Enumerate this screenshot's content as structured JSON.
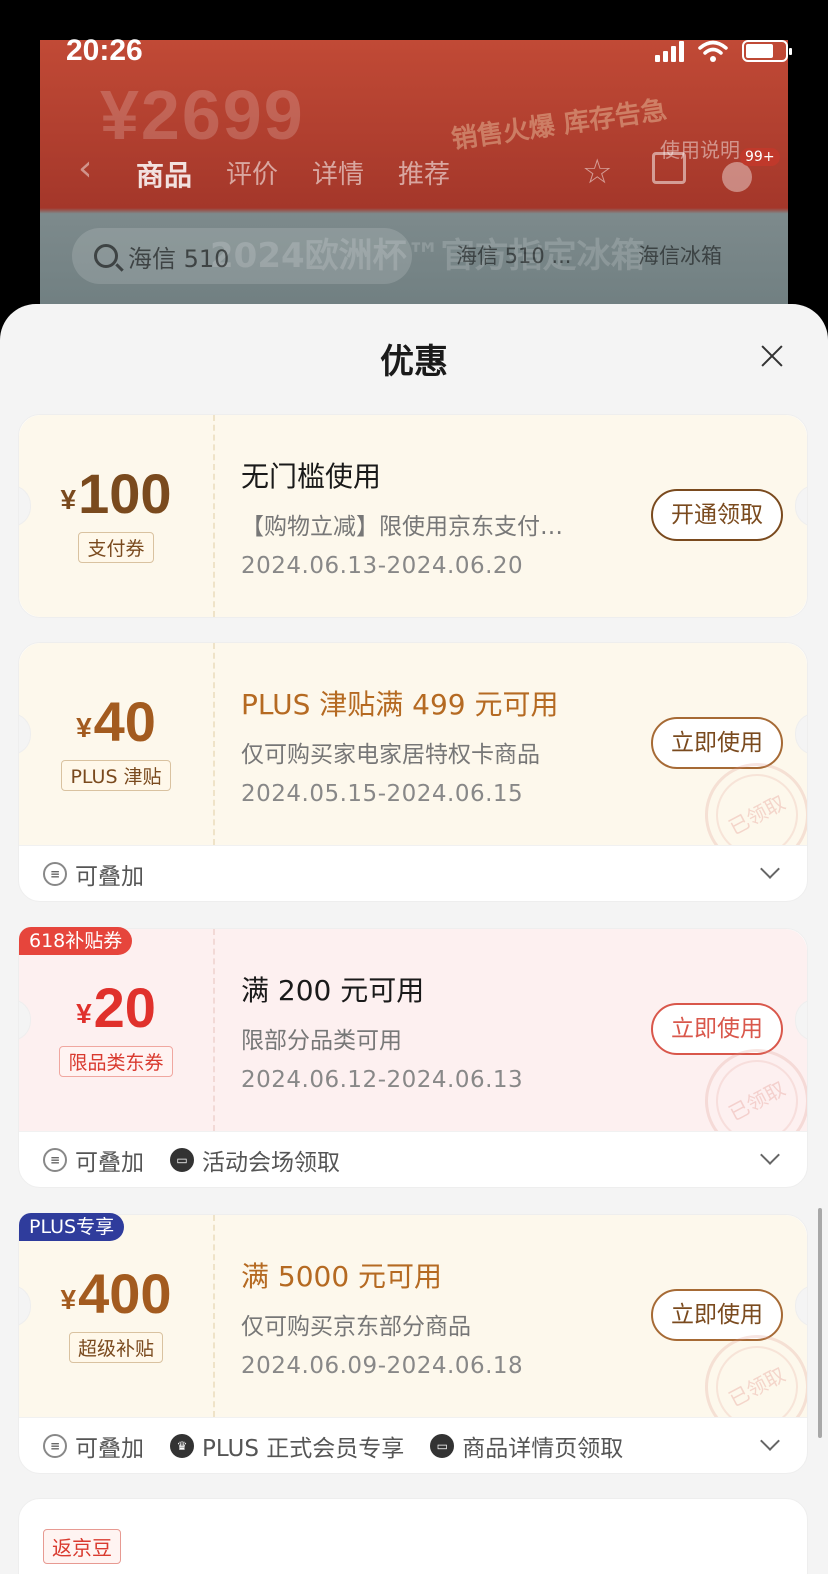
{
  "status_bar": {
    "time": "20:26"
  },
  "background_page": {
    "banner_price": "¥2699",
    "banner_promo": "销售火爆 库存告急",
    "banner_euro": "2024欧洲杯™官方指定冰箱",
    "tabs": [
      "商品",
      "评价",
      "详情",
      "推荐"
    ],
    "help_label": "使用说明",
    "cart_badge": "99+",
    "search_text": "海信 510",
    "chips": [
      "海信 510 ...",
      "海信冰箱"
    ]
  },
  "sheet": {
    "title": "优惠",
    "coupons": [
      {
        "currency": "¥",
        "amount": "100",
        "type": "支付券",
        "title": "无门槛使用",
        "desc": "【购物立减】限使用京东支付…",
        "date": "2024.06.13-2024.06.20",
        "action": "开通领取"
      },
      {
        "currency": "¥",
        "amount": "40",
        "type": "PLUS 津贴",
        "title": "PLUS 津贴满 499 元可用",
        "desc": "仅可购买家电家居特权卡商品",
        "date": "2024.05.15-2024.06.15",
        "action": "立即使用",
        "stamp": "已领取",
        "features": [
          "可叠加"
        ]
      },
      {
        "corner_tag": "618补贴券",
        "currency": "¥",
        "amount": "20",
        "type": "限品类东券",
        "title": "满 200 元可用",
        "desc": "限部分品类可用",
        "date": "2024.06.12-2024.06.13",
        "action": "立即使用",
        "stamp": "已领取",
        "features": [
          "可叠加",
          "活动会场领取"
        ]
      },
      {
        "corner_tag": "PLUS专享",
        "currency": "¥",
        "amount": "400",
        "type": "超级补贴",
        "title": "满 5000 元可用",
        "desc": "仅可购买京东部分商品",
        "date": "2024.06.09-2024.06.18",
        "action": "立即使用",
        "stamp": "已领取",
        "features": [
          "可叠加",
          "PLUS 正式会员专享",
          "商品详情页领取"
        ]
      }
    ],
    "partial_card_tag": "返京豆"
  },
  "colors": {
    "coupon_brown": "#7a4a1e",
    "coupon_red": "#e0312c",
    "plus_gold": "#b56a22",
    "tag_red": "#e6453c",
    "tag_blue": "#2f3c9c"
  }
}
